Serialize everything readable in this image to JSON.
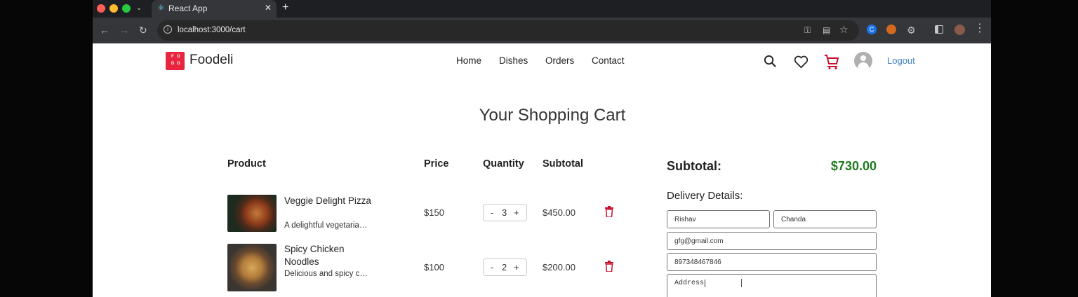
{
  "browser": {
    "tab_title": "React App",
    "url": "localhost:3000/cart",
    "colors": {
      "close": "#ff5f57",
      "minimize": "#febc2e",
      "maximize": "#28c840"
    }
  },
  "header": {
    "logo_text": "Foodeli",
    "logo_letters": [
      "F",
      "O",
      "D",
      "O"
    ],
    "nav": [
      "Home",
      "Dishes",
      "Orders",
      "Contact"
    ],
    "logout": "Logout"
  },
  "cart": {
    "title": "Your Shopping Cart",
    "columns": {
      "product": "Product",
      "price": "Price",
      "quantity": "Quantity",
      "subtotal": "Subtotal"
    },
    "items": [
      {
        "name": "Veggie Delight Pizza",
        "desc": "A delightful vegetarian pizza",
        "price": "$150",
        "qty": "3",
        "subtotal": "$450.00"
      },
      {
        "name": "Spicy Chicken Noodles",
        "desc": "Delicious and spicy chicken noodles",
        "price": "$100",
        "qty": "2",
        "subtotal": "$200.00"
      }
    ],
    "qty_minus": "-",
    "qty_plus": "+"
  },
  "summary": {
    "label": "Subtotal:",
    "value": "$730.00",
    "delivery_label": "Delivery Details:",
    "accent": "#1f7a1f"
  },
  "delivery": {
    "first_name": "Rishav",
    "last_name": "Chanda",
    "email": "gfg@gmail.com",
    "phone": "897348467846",
    "address_placeholder": "Address"
  }
}
